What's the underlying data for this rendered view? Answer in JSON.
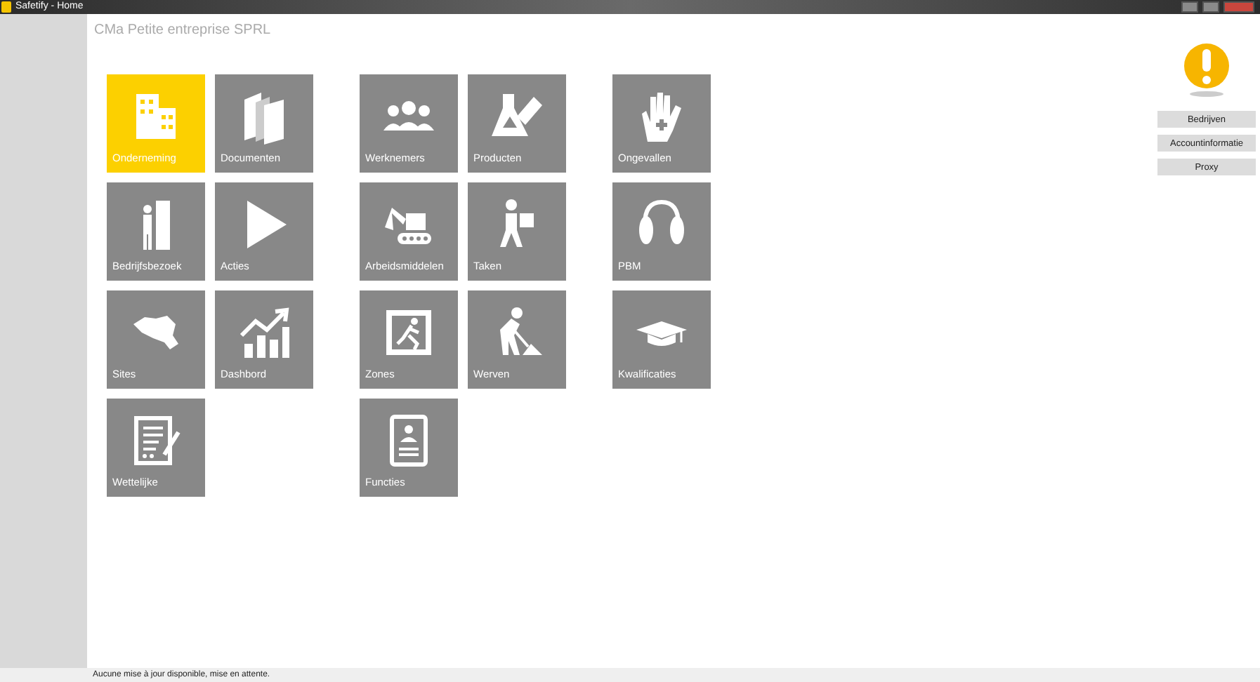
{
  "window": {
    "title": "Safetify - Home"
  },
  "header": "CMa Petite entreprise SPRL",
  "groups": [
    {
      "rows": [
        [
          {
            "label": "Onderneming",
            "kind": "buildings",
            "selected": true
          },
          {
            "label": "Documenten",
            "kind": "books",
            "selected": false
          }
        ],
        [
          {
            "label": "Bedrijfsbezoek",
            "kind": "visitor",
            "selected": false
          },
          {
            "label": "Acties",
            "kind": "play",
            "selected": false
          }
        ],
        [
          {
            "label": "Sites",
            "kind": "map",
            "selected": false
          },
          {
            "label": "Dashbord",
            "kind": "chart",
            "selected": false
          }
        ],
        [
          {
            "label": "Wettelijke",
            "kind": "document",
            "selected": false
          }
        ]
      ]
    },
    {
      "rows": [
        [
          {
            "label": "Werknemers",
            "kind": "people",
            "selected": false
          },
          {
            "label": "Producten",
            "kind": "flask",
            "selected": false
          }
        ],
        [
          {
            "label": "Arbeidsmiddelen",
            "kind": "excavator",
            "selected": false
          },
          {
            "label": "Taken",
            "kind": "carrier",
            "selected": false
          }
        ],
        [
          {
            "label": "Zones",
            "kind": "exit",
            "selected": false
          },
          {
            "label": "Werven",
            "kind": "worker",
            "selected": false
          }
        ],
        [
          {
            "label": "Functies",
            "kind": "badge",
            "selected": false
          }
        ]
      ]
    },
    {
      "rows": [
        [
          {
            "label": "Ongevallen",
            "kind": "hand",
            "selected": false
          }
        ],
        [
          {
            "label": "PBM",
            "kind": "earmuffs",
            "selected": false
          }
        ],
        [
          {
            "label": "Kwalificaties",
            "kind": "cap",
            "selected": false
          }
        ]
      ]
    }
  ],
  "side_buttons": [
    "Bedrijven",
    "Accountinformatie",
    "Proxy"
  ],
  "status_bar": "Aucune mise à jour disponible, mise en attente."
}
